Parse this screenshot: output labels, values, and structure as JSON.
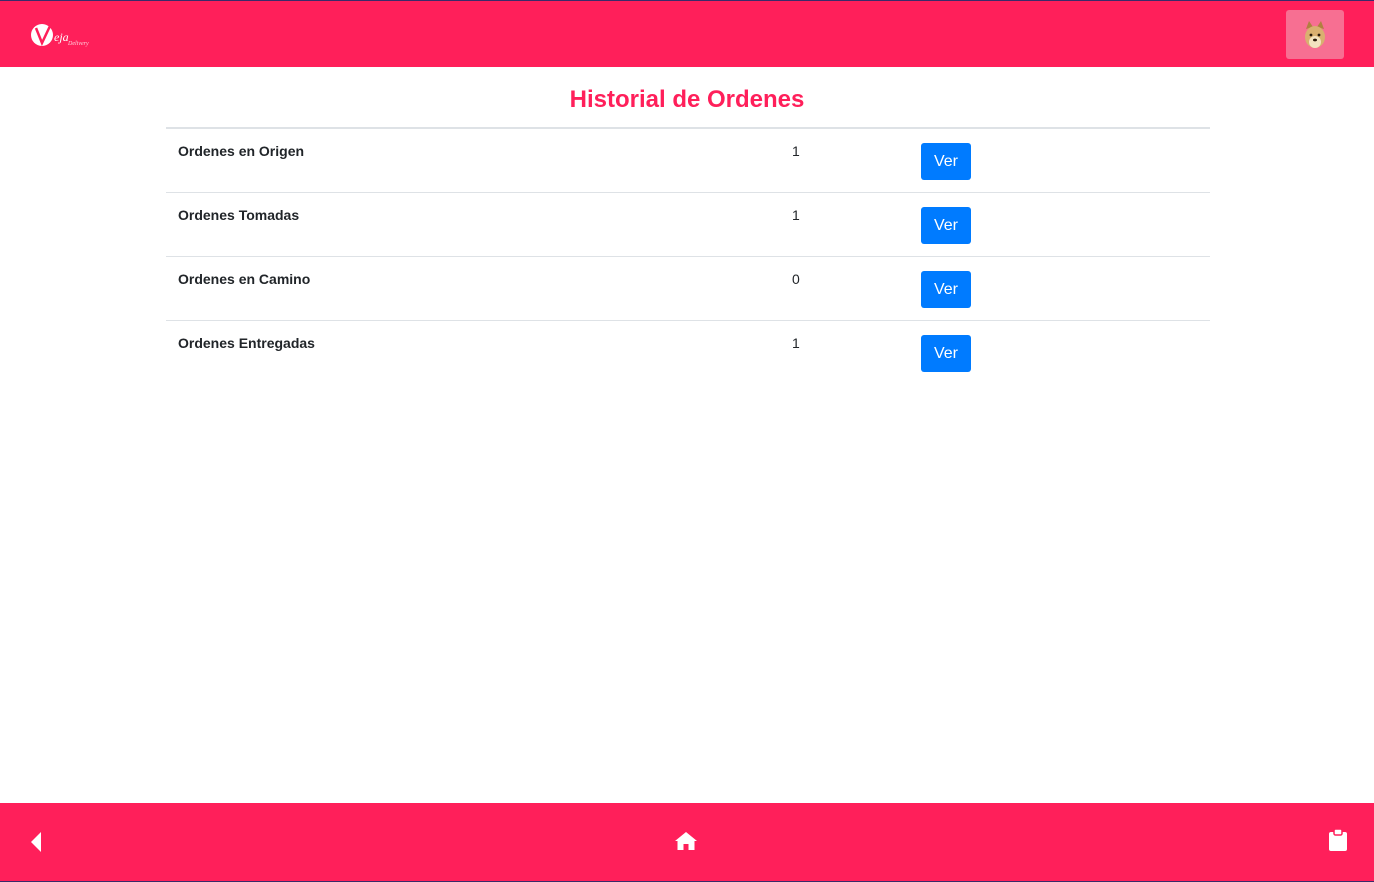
{
  "header": {
    "logo": {
      "icon": "brand-logo",
      "text": "Veja Delivery"
    },
    "avatar": {
      "icon": "doge-avatar"
    }
  },
  "page": {
    "title": "Historial de Ordenes"
  },
  "orders_table": {
    "rows": [
      {
        "label": "Ordenes en Origen",
        "count": "1",
        "button": "Ver"
      },
      {
        "label": "Ordenes Tomadas",
        "count": "1",
        "button": "Ver"
      },
      {
        "label": "Ordenes en Camino",
        "count": "0",
        "button": "Ver"
      },
      {
        "label": "Ordenes Entregadas",
        "count": "1",
        "button": "Ver"
      }
    ]
  },
  "footer": {
    "icons": [
      "back-arrow-icon",
      "home-icon",
      "clipboard-icon"
    ]
  },
  "colors": {
    "brand": "#ff1f5a",
    "button": "#007bff",
    "avatar_bg": "#f76f92"
  }
}
